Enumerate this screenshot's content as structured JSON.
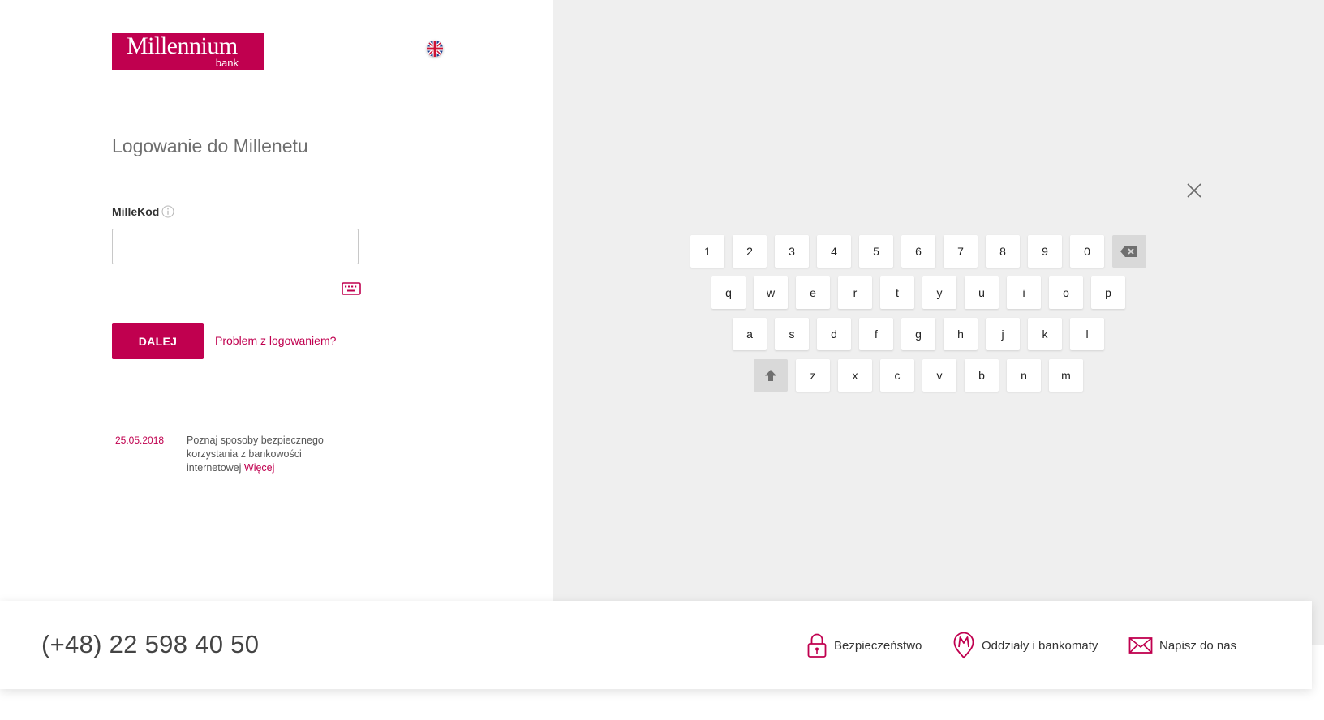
{
  "brand": {
    "name": "Millennium",
    "sub": "bank",
    "color": "#c0004f"
  },
  "language": {
    "flag": "uk-flag"
  },
  "page": {
    "title": "Logowanie do Millenetu"
  },
  "login": {
    "field_label": "MilleKod",
    "input_value": "",
    "next_button": "DALEJ",
    "problem_link": "Problem z logowaniem?"
  },
  "news": {
    "date": "25.05.2018",
    "text": "Poznaj sposoby bezpiecznego korzystania z bankowości internetowej",
    "more": "Więcej"
  },
  "keyboard": {
    "row1": [
      "1",
      "2",
      "3",
      "4",
      "5",
      "6",
      "7",
      "8",
      "9",
      "0"
    ],
    "row2": [
      "q",
      "w",
      "e",
      "r",
      "t",
      "y",
      "u",
      "i",
      "o",
      "p"
    ],
    "row3": [
      "a",
      "s",
      "d",
      "f",
      "g",
      "h",
      "j",
      "k",
      "l"
    ],
    "row4": [
      "z",
      "x",
      "c",
      "v",
      "b",
      "n",
      "m"
    ]
  },
  "footer": {
    "phone": "(+48) 22 598 40 50",
    "links": [
      {
        "label": "Bezpieczeństwo",
        "icon": "lock-icon"
      },
      {
        "label": "Oddziały i bankomaty",
        "icon": "map-pin-icon"
      },
      {
        "label": "Napisz do nas",
        "icon": "envelope-icon"
      }
    ]
  }
}
